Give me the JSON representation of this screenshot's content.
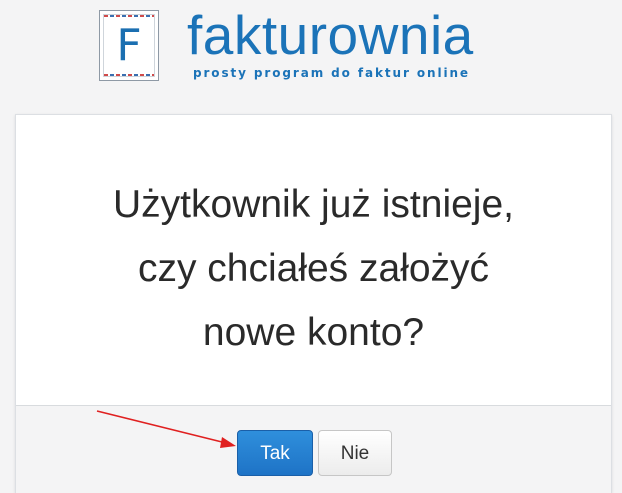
{
  "logo": {
    "letter": "F",
    "name": "fakturownia",
    "tagline": "prosty program do faktur online"
  },
  "dialog": {
    "message_lines": [
      "Użytkownik już istnieje,",
      "czy chciałeś założyć",
      "nowe konto?"
    ],
    "yes_label": "Tak",
    "no_label": "Nie"
  },
  "colors": {
    "brand": "#1b73b8",
    "primary_button": "#1e73c6",
    "annotation_arrow": "#e02020"
  },
  "icons": {
    "logo": "letter-f-stamp-icon",
    "annotation": "red-arrow-icon"
  }
}
